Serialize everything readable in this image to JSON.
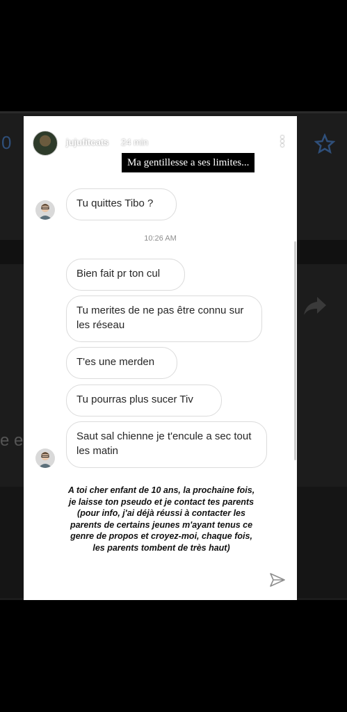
{
  "story": {
    "username": "jujufitcats",
    "time": "24 min",
    "caption": "Ma gentillesse a ses limites..."
  },
  "chat": {
    "timestamp": "10:26 AM",
    "messages": [
      "Tu quittes Tibo ?",
      "Bien fait pr ton cul",
      "Tu merites de ne pas être connu sur les réseau",
      "T'es une merden",
      "Tu pourras plus sucer Tiv",
      "Saut sal chienne je t'encule a sec tout les matin"
    ]
  },
  "overlay_text": "A toi cher enfant de 10 ans, la prochaine fois, je laisse ton pseudo et je contact tes parents (pour info, j'ai déjà réussi à contacter les parents de certains jeunes m'ayant tenus ce genre de propos et croyez-moi, chaque fois, les parents tombent de très haut)",
  "background": {
    "left_number": "0",
    "left_word": "e e"
  },
  "icons": [
    "more-icon",
    "send-icon",
    "star-icon",
    "share-icon"
  ],
  "colors": {
    "page": "#000000",
    "story_bg": "#ffffff",
    "caption_bg": "#000000",
    "bubble_border": "#dbdbdb"
  }
}
